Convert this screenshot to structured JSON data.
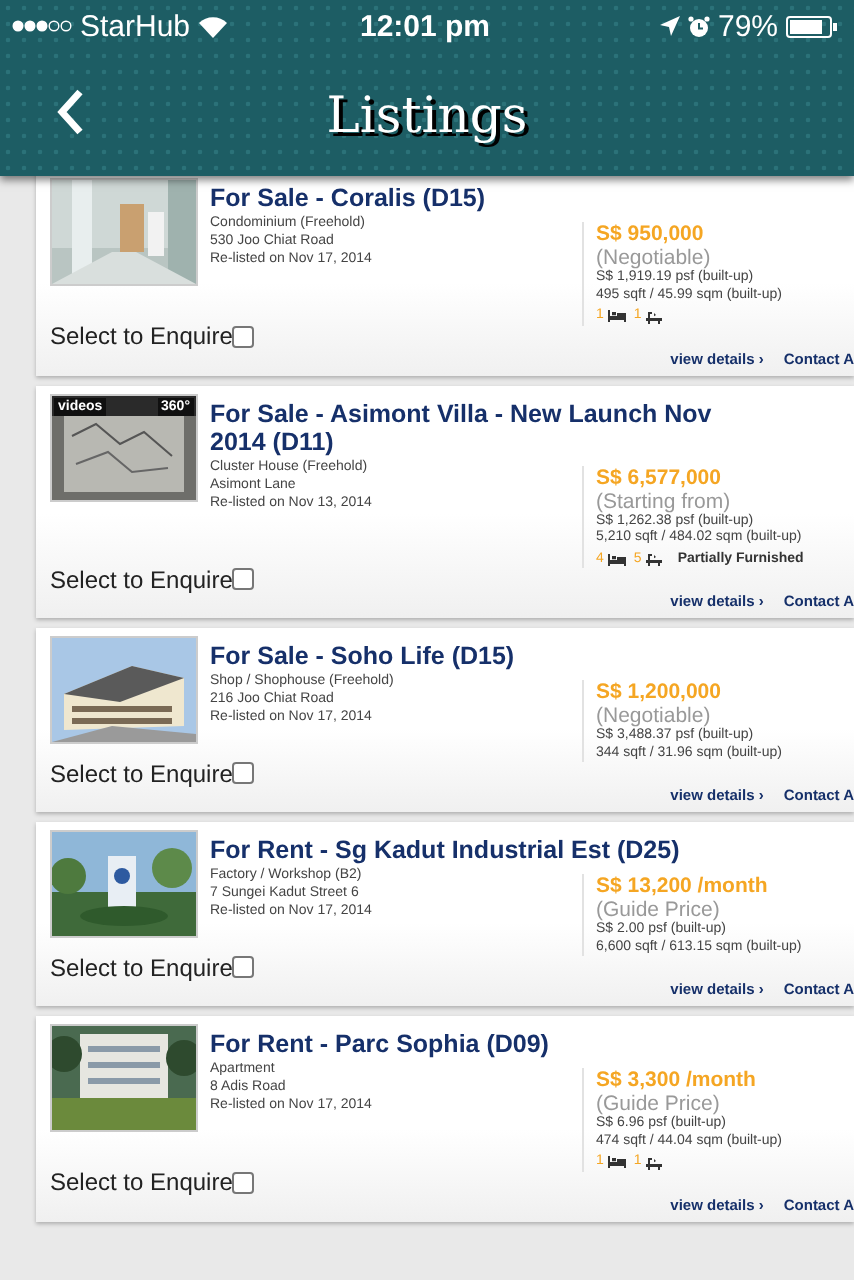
{
  "status_bar": {
    "carrier": "StarHub",
    "time": "12:01 pm",
    "battery": "79%"
  },
  "nav": {
    "title": "Listings"
  },
  "listings": [
    {
      "title": "For Sale - Coralis (D15)",
      "type": "Condominium (Freehold)",
      "address": "530 Joo Chiat Road",
      "listed": "Re-listed on Nov 17, 2014",
      "price": "S$ 950,000",
      "price_note": "(Negotiable)",
      "psf": "S$ 1,919.19 psf (built-up)",
      "area": "495 sqft / 45.99 sqm (built-up)",
      "beds": "1",
      "baths": "1",
      "enquire_label": "Select to Enquire",
      "checked": false,
      "links": [
        "view details ›",
        "Contact A"
      ]
    },
    {
      "title": "For Sale - Asimont Villa - New Launch Nov 2014 (D11)",
      "badges": [
        {
          "kind": "video",
          "label": "videos"
        },
        {
          "kind": "panorama",
          "label": "360°"
        }
      ],
      "type": "Cluster House (Freehold)",
      "address": "Asimont Lane",
      "listed": "Re-listed on Nov 13, 2014",
      "price": "S$ 6,577,000",
      "price_note": "(Starting from)",
      "psf": "S$ 1,262.38 psf (built-up)",
      "area": "5,210 sqft / 484.02 sqm (built-up)",
      "beds": "4",
      "baths": "5",
      "furnishing": "Partially Furnished",
      "enquire_label": "Select to Enquire",
      "checked": false,
      "links": [
        "view details ›",
        "Contact A"
      ]
    },
    {
      "title": "For Sale - Soho Life (D15)",
      "type": "Shop / Shophouse (Freehold)",
      "address": "216 Joo Chiat Road",
      "listed": "Re-listed on Nov 17, 2014",
      "price": "S$ 1,200,000",
      "price_note": "(Negotiable)",
      "psf": "S$ 3,488.37 psf (built-up)",
      "area": "344 sqft / 31.96 sqm (built-up)",
      "enquire_label": "Select to Enquire",
      "checked": false,
      "links": [
        "view details ›",
        "Contact A"
      ]
    },
    {
      "title": "For Rent - Sg Kadut Industrial Est (D25)",
      "type": "Factory / Workshop (B2)",
      "address": "7 Sungei Kadut Street 6",
      "listed": "Re-listed on Nov 17, 2014",
      "price": "S$ 13,200 /month",
      "price_note": "(Guide Price)",
      "psf": "S$ 2.00 psf (built-up)",
      "area": "6,600 sqft / 613.15 sqm (built-up)",
      "enquire_label": "Select to Enquire",
      "checked": false,
      "links": [
        "view details ›",
        "Contact A"
      ]
    },
    {
      "title": "For Rent - Parc Sophia (D09)",
      "type": "Apartment",
      "address": "8 Adis Road",
      "listed": "Re-listed on Nov 17, 2014",
      "price": "S$ 3,300 /month",
      "price_note": "(Guide Price)",
      "psf": "S$ 6.96 psf (built-up)",
      "area": "474 sqft / 44.04 sqm (built-up)",
      "beds": "1",
      "baths": "1",
      "enquire_label": "Select to Enquire",
      "checked": false,
      "links": [
        "view details ›",
        "Contact A"
      ]
    }
  ]
}
